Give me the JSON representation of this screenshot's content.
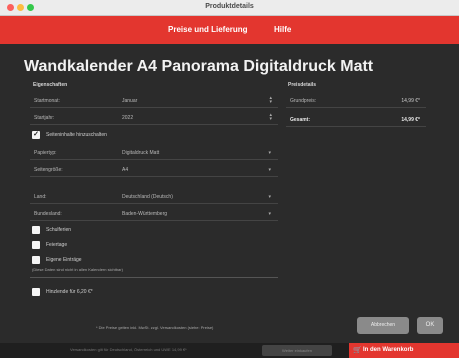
{
  "window": {
    "title": "Produktdetails"
  },
  "menu": {
    "prices": "Preise und Lieferung",
    "help": "Hilfe"
  },
  "product": {
    "title": "Wandkalender A4 Panorama Digitaldruck Matt"
  },
  "properties": {
    "heading": "Eigenschaften",
    "rows": [
      {
        "label": "Startmonat:",
        "value": "Januar"
      },
      {
        "label": "Startjahr:",
        "value": "2022"
      },
      {
        "label": "Papiertyp:",
        "value": "Digitaldruck Matt"
      },
      {
        "label": "Seitengröße:",
        "value": "A4"
      },
      {
        "label": "Land:",
        "value": "Deutschland (Deutsch)"
      },
      {
        "label": "Bundesland:",
        "value": "Baden-Württemberg"
      }
    ],
    "show_holidays": "Seiteninhalte hinzuschalten",
    "options": [
      "Schulferien",
      "Feiertage",
      "Eigene Einträge"
    ],
    "hint": "(Diese Daten sind nicht in allen Kalendern sichtbar)",
    "hardcover": "Hinzlende für 6,20 €*"
  },
  "prices": {
    "heading": "Preisdetails",
    "base_label": "Grundpreis:",
    "base_value": "14,99 €*",
    "total_label": "Gesamt:",
    "total_value": "14,99 €*"
  },
  "footer": {
    "note": "* Die Preise gelten inkl. MwSt. zzgl. Versandkosten (siehe: Preise)",
    "secondary_button": "Abbrechen",
    "ok_button": "OK",
    "bottom_info": "Versandkosten gilt für Deutschland, Österreich und UWE 14,99 €*",
    "bottom_mid": "Weiter einkaufen",
    "cart": "In den Warenkorb"
  }
}
